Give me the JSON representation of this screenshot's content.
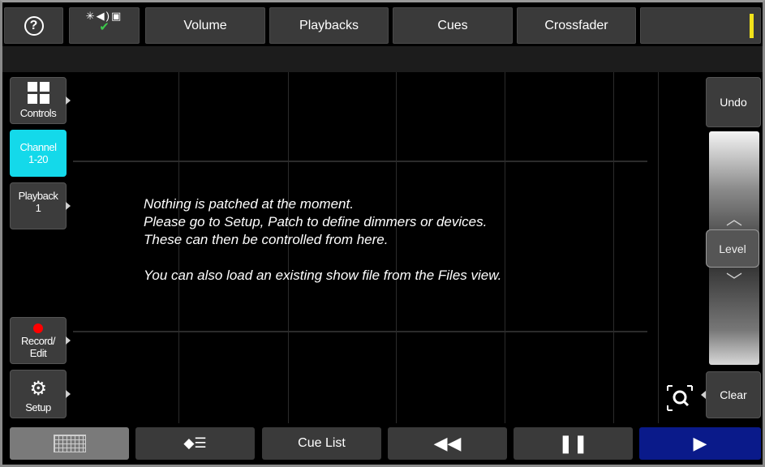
{
  "topbar": {
    "help_icon": "question-circle-icon",
    "help_glyph": "?",
    "status_icons": "✳◀)▣",
    "status_check": "✔",
    "tabs": [
      {
        "label": "Volume"
      },
      {
        "label": "Playbacks"
      },
      {
        "label": "Cues"
      },
      {
        "label": "Crossfader"
      }
    ],
    "indicator_color": "#f2e21a"
  },
  "sidebar": {
    "items": [
      {
        "label": "Controls",
        "icon": "grid-icon"
      },
      {
        "label": "Channel 1-20",
        "line1": "Channel",
        "line2": "1-20",
        "active": true,
        "color": "#14d9ea"
      },
      {
        "label": "Playback 1",
        "line1": "Playback",
        "line2": "1"
      },
      {
        "label": "Record/ Edit",
        "line1": "Record/",
        "line2": "Edit",
        "icon": "record-dot-icon"
      },
      {
        "label": "Setup",
        "icon": "gear-icon"
      }
    ]
  },
  "main": {
    "message_lines": [
      "Nothing is patched at the moment.",
      "Please go to Setup, Patch to define dimmers or devices.",
      "These can then be controlled from here.",
      "",
      "You can also load an existing show file from the Files view."
    ]
  },
  "rightpanel": {
    "undo_label": "Undo",
    "level_label": "Level",
    "clear_label": "Clear",
    "up_glyph": "︿",
    "down_glyph": "﹀",
    "zoom_icon": "zoom-fit-icon"
  },
  "bottombar": {
    "grid_icon": "grid-view-icon",
    "palette_icon": "palette-icon",
    "palette_glyph": "◆☰",
    "cue_list_label": "Cue List",
    "rewind_glyph": "◀◀",
    "pause_glyph": "❚❚",
    "play_glyph": "▶",
    "play_color": "#0a1a8a"
  }
}
